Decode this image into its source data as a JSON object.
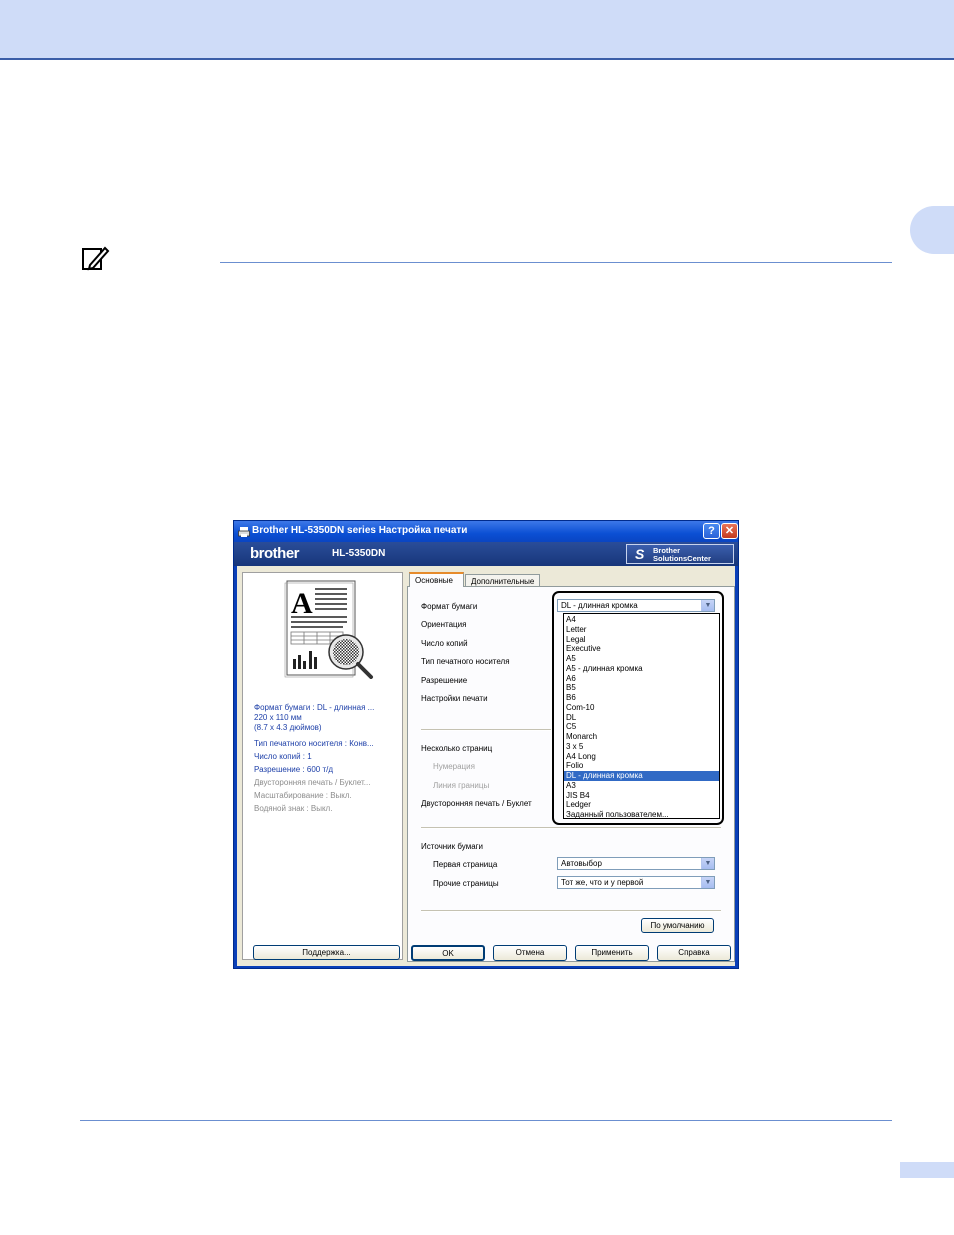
{
  "dialog": {
    "title": "Brother HL-5350DN series Настройка печати",
    "help_glyph": "?",
    "close_glyph": "✕",
    "brand": "brother",
    "model": "HL-5350DN",
    "solutions_line1": "Brother",
    "solutions_line2": "SolutionsCenter"
  },
  "summary": [
    {
      "text": "Формат бумаги : DL - длинная ...",
      "style": "blue"
    },
    {
      "text": "220 x 110 мм",
      "style": "blue"
    },
    {
      "text": "(8.7 x 4.3 дюймов)",
      "style": "blue"
    },
    {
      "text": "Тип печатного носителя : Конв...",
      "style": "blue"
    },
    {
      "text": "Число копий : 1",
      "style": "blue"
    },
    {
      "text": "Разрешение : 600 т/д",
      "style": "blue"
    },
    {
      "text": "Двусторонняя печать / Буклет...",
      "style": "gray"
    },
    {
      "text": "Масштабирование : Выкл.",
      "style": "gray"
    },
    {
      "text": "Водяной знак : Выкл.",
      "style": "gray"
    }
  ],
  "support_label": "Поддержка...",
  "tabs": {
    "basic": "Основные",
    "advanced": "Дополнительные"
  },
  "labels": {
    "paper_size": "Формат бумаги",
    "orientation": "Ориентация",
    "copies": "Число копий",
    "media_type": "Тип печатного носителя",
    "resolution": "Разрешение",
    "print_settings": "Настройки печати",
    "multiple_pages": "Несколько страниц",
    "numbering": "Нумерация",
    "border_line": "Линия границы",
    "duplex": "Двусторонняя печать / Буклет",
    "paper_source": "Источник бумаги",
    "first_page": "Первая страница",
    "other_pages": "Прочие страницы"
  },
  "paper_size_value": "DL - длинная кромка",
  "first_page_value": "Автовыбор",
  "other_pages_value": "Тот же, что и у первой",
  "dropdown_arrow": "▼",
  "dropdown_items": [
    "A4",
    "Letter",
    "Legal",
    "Executive",
    "A5",
    "A5 - длинная кромка",
    "A6",
    "B5",
    "B6",
    "Com-10",
    "DL",
    "C5",
    "Monarch",
    "3 x 5",
    "A4 Long",
    "Folio",
    "DL - длинная кромка",
    "A3",
    "JIS B4",
    "Ledger",
    "Заданный пользователем..."
  ],
  "dropdown_selected": "DL - длинная кромка",
  "buttons": {
    "default": "По умолчанию",
    "ok": "OK",
    "cancel": "Отмена",
    "apply": "Применить",
    "help": "Справка"
  },
  "colors": {
    "page_band": "#cfdcf8",
    "rule": "#6b8fd0",
    "titlebar": "#0b4fd4",
    "selection": "#316ac5"
  }
}
